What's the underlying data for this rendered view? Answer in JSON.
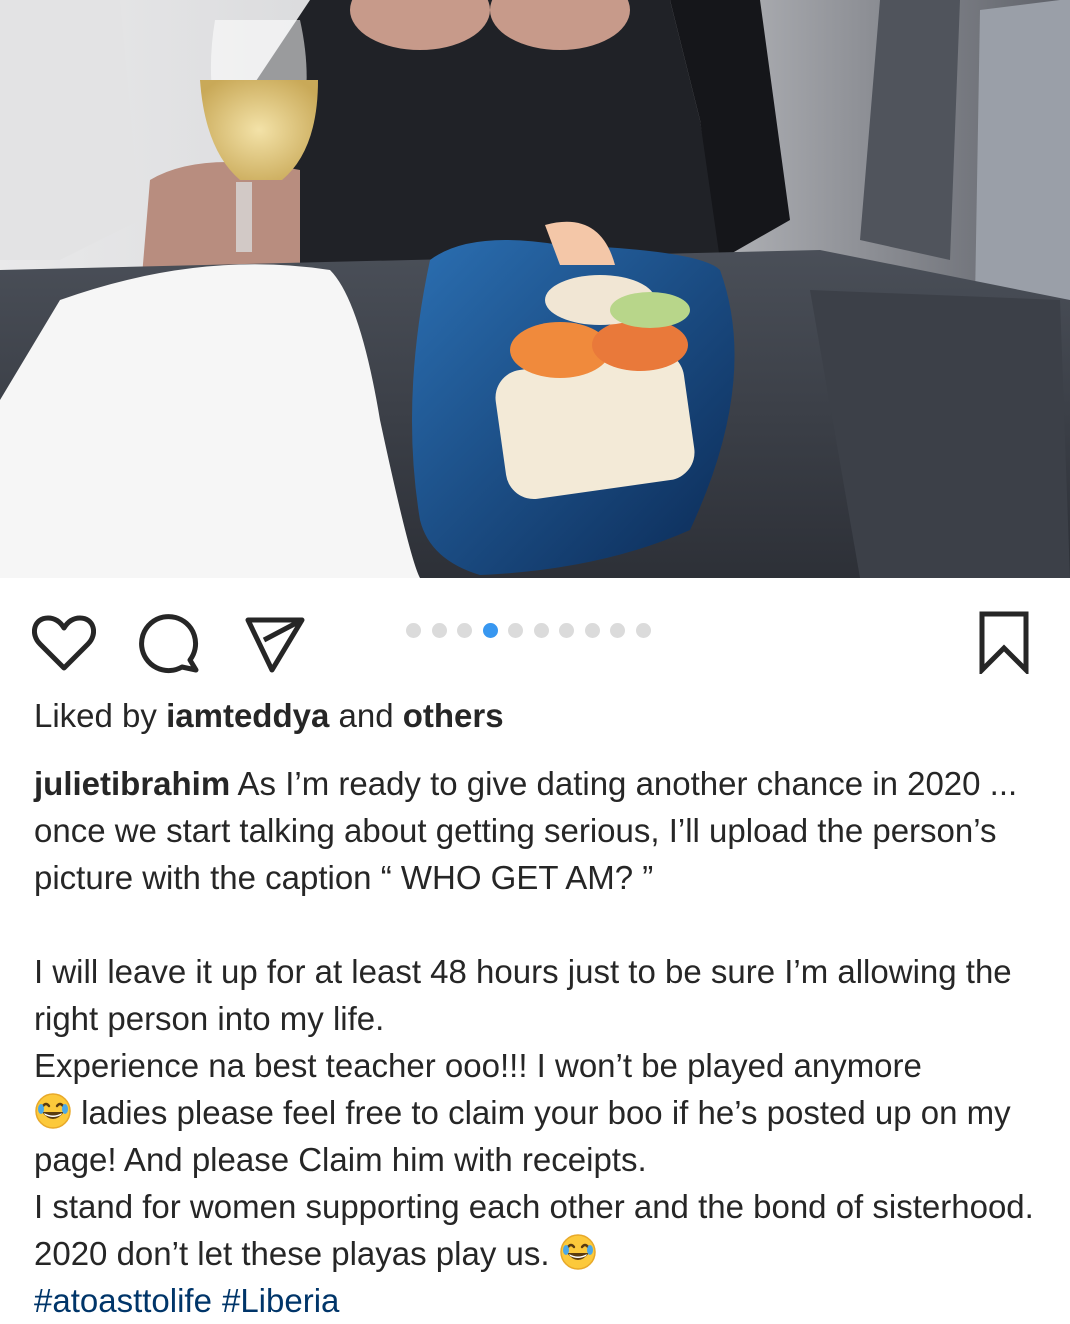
{
  "post": {
    "image_alt": "",
    "carousel": {
      "count": 10,
      "active_index": 3
    }
  },
  "actions": {
    "like_icon": "heart-icon",
    "comment_icon": "comment-icon",
    "share_icon": "paper-plane-icon",
    "save_icon": "bookmark-icon"
  },
  "likes": {
    "prefix": "Liked by ",
    "user": "iamteddya",
    "middle": " and ",
    "others": "others"
  },
  "caption": {
    "username": "julietibrahim",
    "p1": " As I’m ready to give dating another chance in 2020 ... once we start talking about getting serious, I’ll upload the person’s picture with the caption “ WHO GET AM? ”",
    "p2": "I will leave it up for at least 48 hours just to be sure I’m allowing the right person into my life.",
    "p3": "Experience na best teacher ooo!!! I won’t be played anymore",
    "p4": " ladies please feel free to claim your boo if he’s posted up on my page! And please Claim him with receipts.",
    "p5": "I stand for women supporting each other and the bond of sisterhood. 2020 don’t let these playas play us.",
    "hashtags": [
      "#atoasttolife",
      "#Liberia"
    ]
  },
  "colors": {
    "accent": "#3897f0",
    "hashtag": "#003569",
    "text": "#262626",
    "dot_inactive": "#dbdbdb"
  }
}
